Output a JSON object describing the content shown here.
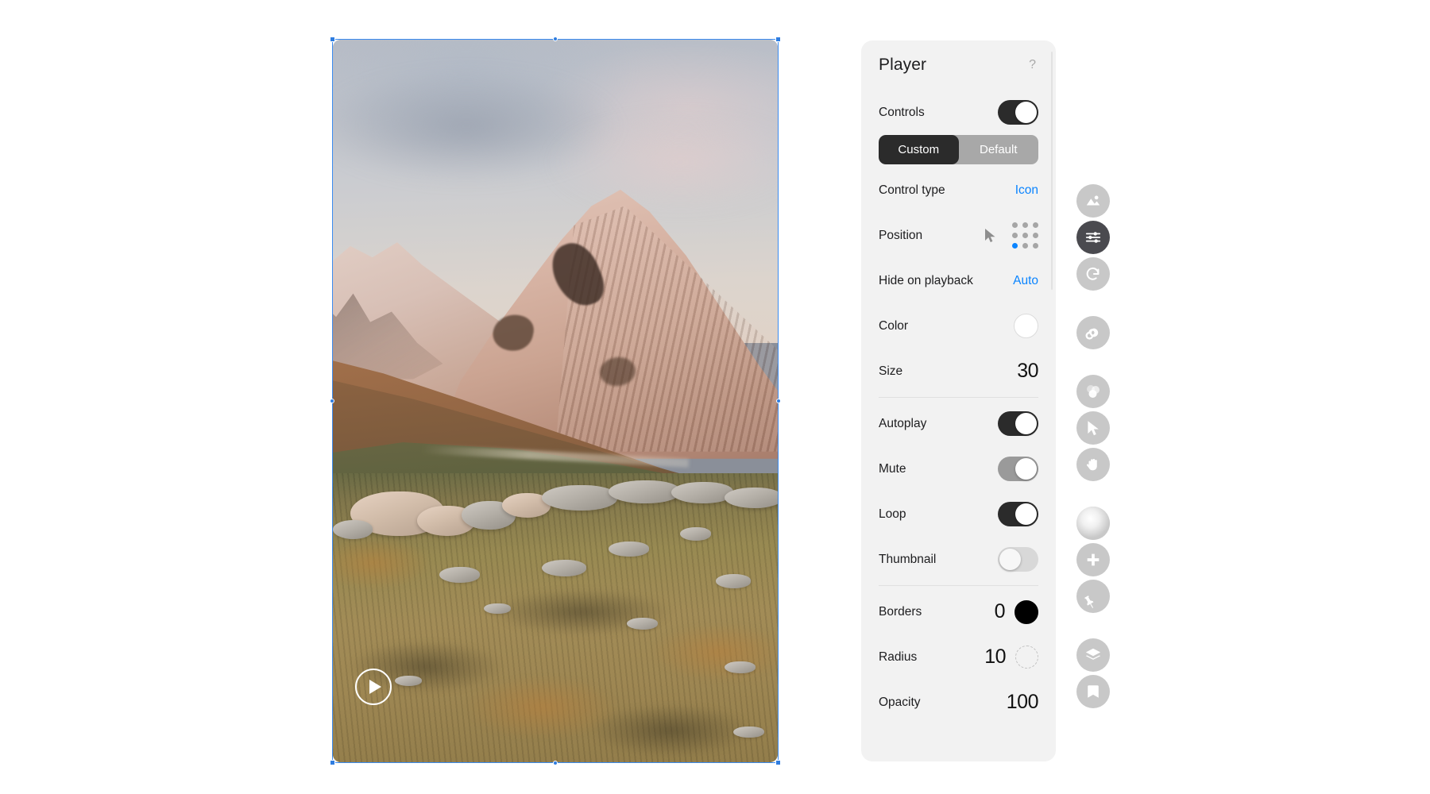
{
  "panel": {
    "title": "Player",
    "help_icon": "question-mark-icon",
    "controls": {
      "label": "Controls",
      "state": "on"
    },
    "mode_segments": [
      {
        "label": "Custom",
        "active": true
      },
      {
        "label": "Default",
        "active": false
      }
    ],
    "control_type": {
      "label": "Control type",
      "value": "Icon"
    },
    "position": {
      "label": "Position",
      "cursor_icon": "cursor-arrow-icon",
      "grid_selected_index": 6,
      "grid_cells": 9
    },
    "hide_on_playback": {
      "label": "Hide on playback",
      "value": "Auto"
    },
    "color": {
      "label": "Color",
      "value": "#ffffff"
    },
    "size": {
      "label": "Size",
      "value": "30"
    },
    "autoplay": {
      "label": "Autoplay",
      "state": "on"
    },
    "mute": {
      "label": "Mute",
      "state": "mid"
    },
    "loop": {
      "label": "Loop",
      "state": "on"
    },
    "thumbnail": {
      "label": "Thumbnail",
      "state": "off"
    },
    "borders": {
      "label": "Borders",
      "value": "0",
      "color": "#000000"
    },
    "radius": {
      "label": "Radius",
      "value": "10"
    },
    "opacity": {
      "label": "Opacity",
      "value": "100"
    }
  },
  "toolbar": {
    "items": [
      {
        "name": "image-icon",
        "active": false
      },
      {
        "name": "sliders-icon",
        "active": true
      },
      {
        "name": "redo-icon",
        "active": false
      },
      {
        "name": "infinity-icon",
        "active": false
      },
      {
        "name": "blend-circles-icon",
        "active": false
      },
      {
        "name": "cursor-icon",
        "active": false
      },
      {
        "name": "hand-icon",
        "active": false
      },
      {
        "name": "gradient-sphere-icon",
        "active": false
      },
      {
        "name": "plus-icon",
        "active": false
      },
      {
        "name": "pin-icon",
        "active": false
      },
      {
        "name": "layers-icon",
        "active": false
      },
      {
        "name": "bookmark-icon",
        "active": false
      }
    ]
  },
  "canvas": {
    "play_button_icon": "play-icon",
    "selection_active": true
  },
  "colors": {
    "accent": "#0a84ff",
    "selection": "#3b8bf0",
    "toggle_on": "#2b2b2b",
    "toggle_mid": "#9a9a9a",
    "toggle_off": "#d8d8d8",
    "panel_bg": "#f2f2f2"
  }
}
